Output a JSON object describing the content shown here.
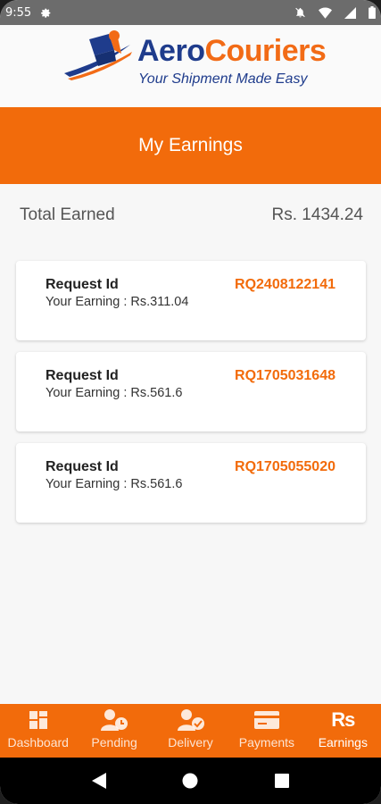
{
  "status_bar": {
    "time": "9:55",
    "icons": [
      "gear-icon",
      "notification-off-icon",
      "wifi-icon",
      "signal-icon",
      "battery-icon"
    ]
  },
  "brand": {
    "name_part1": "Aero",
    "name_part2": "Couriers",
    "tagline": "Your Shipment Made Easy",
    "colors": {
      "navy": "#1f3c8c",
      "orange": "#f26b16"
    }
  },
  "header": {
    "title": "My Earnings",
    "color": "#f26b0b"
  },
  "summary": {
    "label": "Total Earned",
    "value": "Rs. 1434.24"
  },
  "earnings": [
    {
      "label": "Request Id",
      "id": "RQ2408122141",
      "earning": "Your Earning : Rs.311.04"
    },
    {
      "label": "Request Id",
      "id": "RQ1705031648",
      "earning": "Your Earning : Rs.561.6"
    },
    {
      "label": "Request Id",
      "id": "RQ1705055020",
      "earning": "Your Earning : Rs.561.6"
    }
  ],
  "nav": {
    "items": [
      {
        "label": "Dashboard",
        "icon": "dashboard-icon"
      },
      {
        "label": "Pending",
        "icon": "pending-icon"
      },
      {
        "label": "Delivery",
        "icon": "delivery-icon"
      },
      {
        "label": "Payments",
        "icon": "payments-icon"
      },
      {
        "label": "Earnings",
        "icon": "rupee-icon",
        "glyph": "Rs",
        "active": true
      }
    ]
  },
  "system_nav": [
    "back-icon",
    "home-icon",
    "recents-icon"
  ]
}
